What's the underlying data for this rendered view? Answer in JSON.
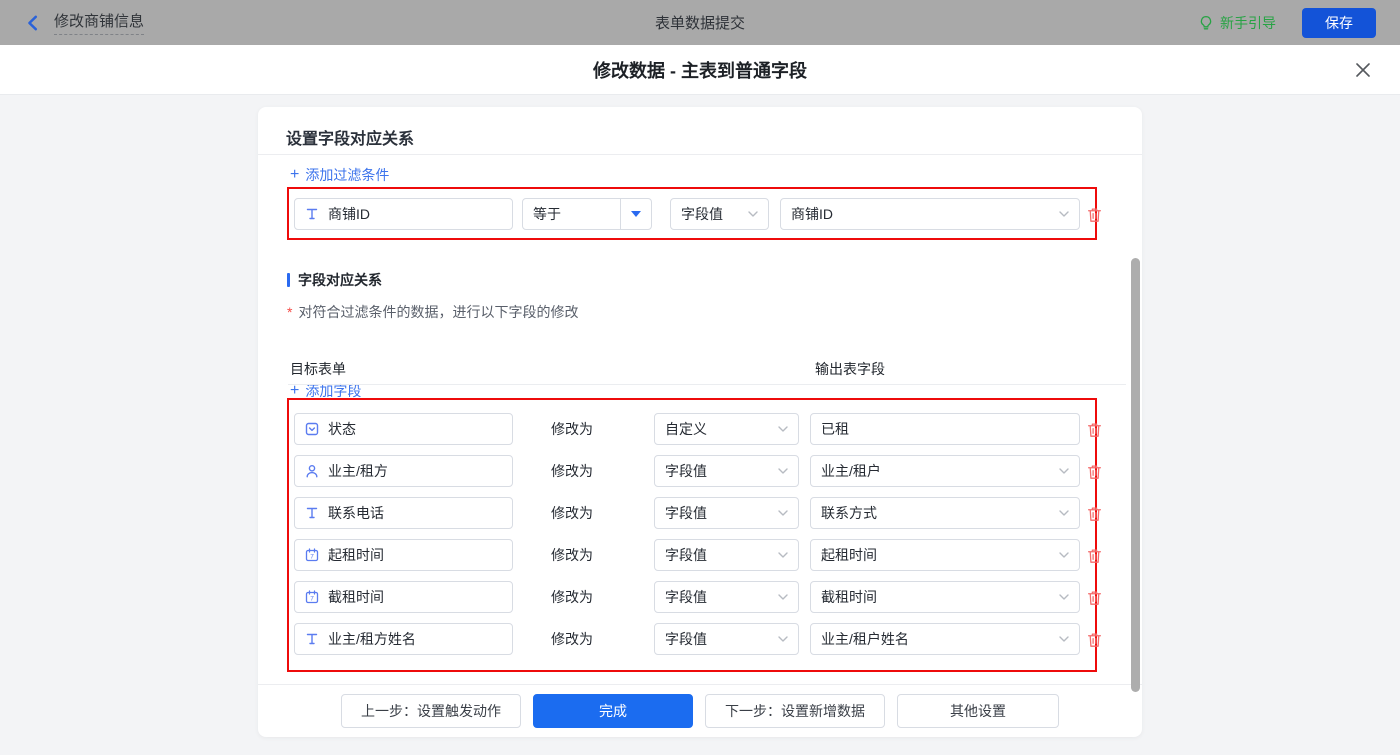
{
  "topbar": {
    "back_label": "修改商铺信息",
    "title": "表单数据提交",
    "guide_label": "新手引导",
    "save_label": "保存"
  },
  "modal": {
    "title": "修改数据 - 主表到普通字段"
  },
  "panel": {
    "header": "设置字段对应关系",
    "plus": "+",
    "add_filter_label": "添加过滤条件",
    "filter": {
      "field": "商铺ID",
      "operator": "等于",
      "value_type": "字段值",
      "value": "商铺ID"
    },
    "mapping": {
      "section_title": "字段对应关系",
      "required_mark": "*",
      "description": "对符合过滤条件的数据，进行以下字段的修改",
      "add_field_label": "添加字段",
      "col_target": "目标表单",
      "col_output": "输出表字段",
      "modify_label": "修改为",
      "rows": [
        {
          "icon": "select-field-icon",
          "target": "状态",
          "type": "自定义",
          "output": "已租"
        },
        {
          "icon": "person-field-icon",
          "target": "业主/租方",
          "type": "字段值",
          "output": "业主/租户"
        },
        {
          "icon": "text-field-icon",
          "target": "联系电话",
          "type": "字段值",
          "output": "联系方式"
        },
        {
          "icon": "date-field-icon",
          "target": "起租时间",
          "type": "字段值",
          "output": "起租时间"
        },
        {
          "icon": "date-field-icon",
          "target": "截租时间",
          "type": "字段值",
          "output": "截租时间"
        },
        {
          "icon": "text-field-icon",
          "target": "业主/租方姓名",
          "type": "字段值",
          "output": "业主/租户姓名"
        }
      ]
    },
    "footer": {
      "prev_label": "上一步：设置触发动作",
      "done_label": "完成",
      "next_label": "下一步：设置新增数据",
      "other_label": "其他设置"
    }
  },
  "colors": {
    "topbar_bg": "#a9a9a9",
    "save_button_blue": "#1353d8",
    "primary_button_blue": "#1b6cf0",
    "link_blue": "#3d74ec",
    "section_bar_blue": "#2a6af0",
    "highlight_red": "#ee0b0b",
    "trash_red": "#f46b6b",
    "guide_green": "#27a344",
    "field_icon_blue": "#5b7cf0",
    "required_red": "#f54a45"
  }
}
